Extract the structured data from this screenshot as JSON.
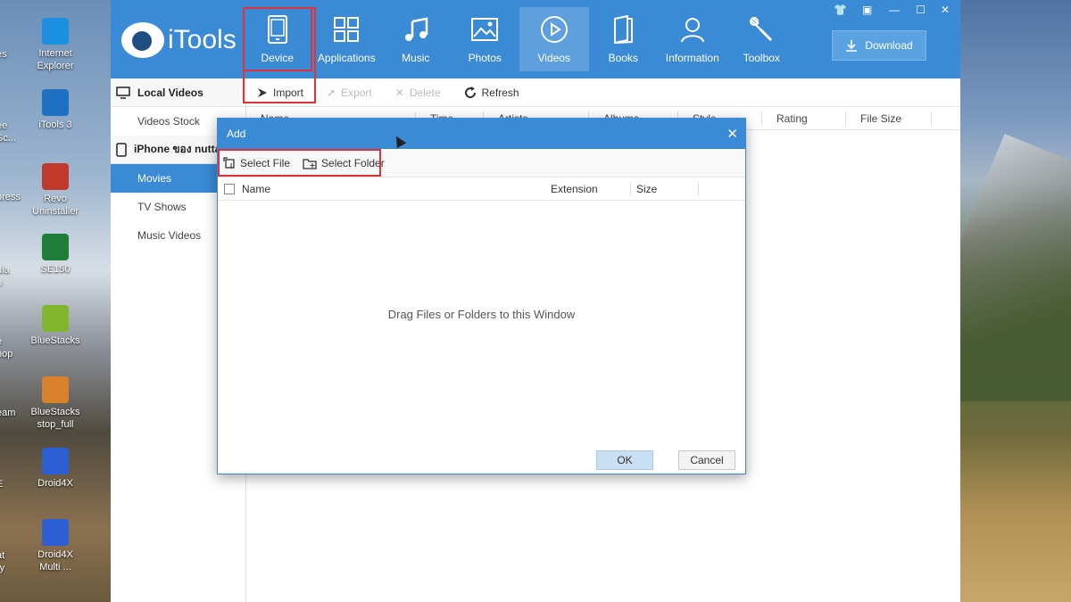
{
  "desktop": {
    "left_icons": [
      {
        "label": "Internet\nExplorer",
        "color": "#1b8fe0"
      },
      {
        "label": "iTools 3",
        "color": "#1f6fc2"
      },
      {
        "label": "Revo\nUninstaller",
        "color": "#c0392b"
      },
      {
        "label": "SE150",
        "color": "#1e7d3a"
      },
      {
        "label": "BlueStacks",
        "color": "#7fb62b"
      },
      {
        "label": "BlueStacks\nstop_full",
        "color": "#d9822b"
      },
      {
        "label": "Droid4X",
        "color": "#2d5ed3"
      },
      {
        "label": "Droid4X\nMulti ...",
        "color": "#2d5ed3"
      }
    ],
    "partial_labels": [
      "es",
      "ee\nSc...",
      "press",
      "dia\nn",
      "e\nhop",
      "eam",
      "E",
      "at\nry"
    ]
  },
  "app": {
    "name": "iTools",
    "nav": [
      {
        "label": "Device",
        "icon": "device-icon"
      },
      {
        "label": "Applications",
        "icon": "applications-icon"
      },
      {
        "label": "Music",
        "icon": "music-icon"
      },
      {
        "label": "Photos",
        "icon": "photos-icon"
      },
      {
        "label": "Videos",
        "icon": "videos-icon",
        "active": true
      },
      {
        "label": "Books",
        "icon": "books-icon"
      },
      {
        "label": "Information",
        "icon": "information-icon"
      },
      {
        "label": "Toolbox",
        "icon": "toolbox-icon"
      }
    ],
    "download_label": "Download"
  },
  "sidebar": {
    "local_header": "Local Videos",
    "local_items": [
      "Videos Stock"
    ],
    "device_header": "iPhone ของ nutta",
    "device_items": [
      {
        "label": "Movies",
        "active": true
      },
      {
        "label": "TV Shows"
      },
      {
        "label": "Music Videos"
      }
    ]
  },
  "toolbar": {
    "import_label": "Import",
    "export_label": "Export",
    "delete_label": "Delete",
    "refresh_label": "Refresh"
  },
  "table": {
    "columns": [
      "Name",
      "Time",
      "Artists",
      "Albums",
      "Style",
      "Rating",
      "File Size"
    ]
  },
  "dialog": {
    "title": "Add",
    "select_file": "Select File",
    "select_folder": "Select Folder",
    "columns": [
      "Name",
      "Extension",
      "Size"
    ],
    "empty_text": "Drag Files or Folders to this Window",
    "ok_label": "OK",
    "cancel_label": "Cancel"
  }
}
